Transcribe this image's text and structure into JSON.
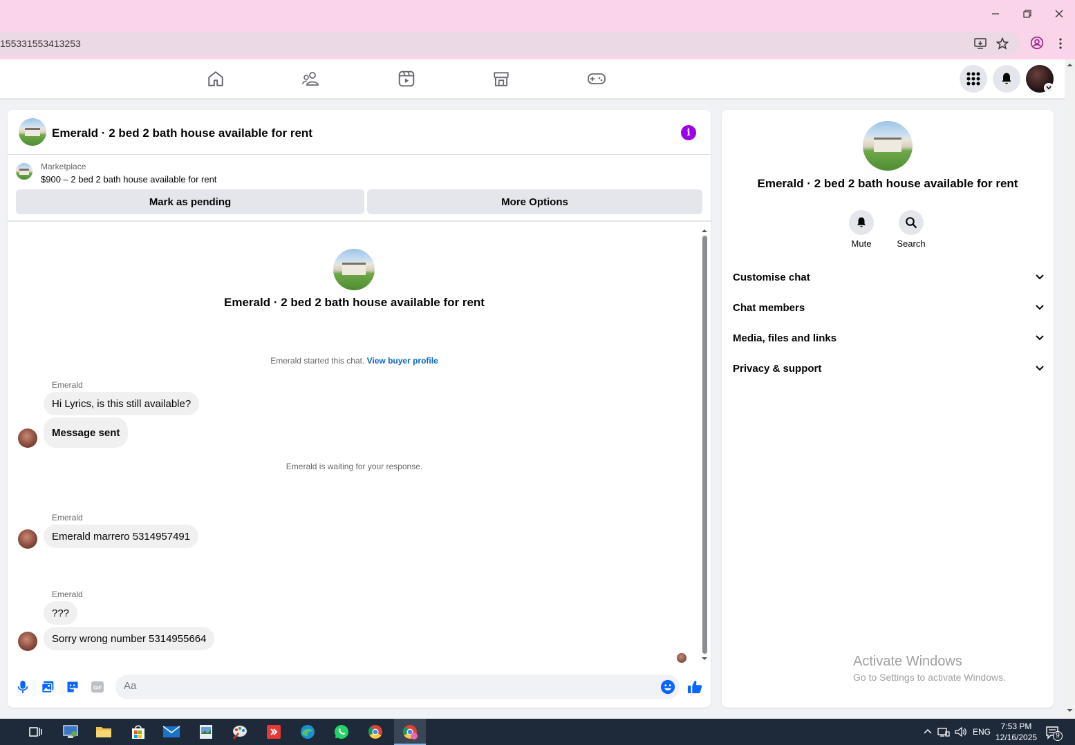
{
  "browser": {
    "url": "155331553413253"
  },
  "chat": {
    "header_title": "Emerald · 2 bed 2 bath house available for rent",
    "marketplace_label": "Marketplace",
    "listing_price_title": "$900 – 2 bed 2 bath house available for rent",
    "mark_pending_label": "Mark as pending",
    "more_options_label": "More Options",
    "center_title": "Emerald · 2 bed 2 bath house available for rent",
    "started_text": "Emerald started this chat.",
    "view_buyer_profile": "View buyer profile",
    "waiting_text": "Emerald is waiting for your response.",
    "groups": [
      {
        "sender": "Emerald",
        "messages": [
          "Hi Lyrics, is this still available?",
          "Message sent"
        ]
      },
      {
        "sender": "Emerald",
        "messages": [
          "Emerald marrero 5314957491"
        ]
      },
      {
        "sender": "Emerald",
        "messages": [
          "???",
          "Sorry wrong number 5314955664"
        ]
      }
    ],
    "composer_placeholder": "Aa"
  },
  "side": {
    "title": "Emerald · 2 bed 2 bath house available for rent",
    "mute_label": "Mute",
    "search_label": "Search",
    "sections": [
      "Customise chat",
      "Chat members",
      "Media, files and links",
      "Privacy & support"
    ]
  },
  "watermark": {
    "line1": "Activate Windows",
    "line2": "Go to Settings to activate Windows."
  },
  "taskbar": {
    "lang": "ENG",
    "time": "7:53 PM",
    "date": "12/16/2025",
    "notification_count": "9"
  },
  "colors": {
    "accent_blue": "#0a66c2",
    "info_purple": "#9c00e6",
    "titlebar_pink": "#fad4e8"
  }
}
